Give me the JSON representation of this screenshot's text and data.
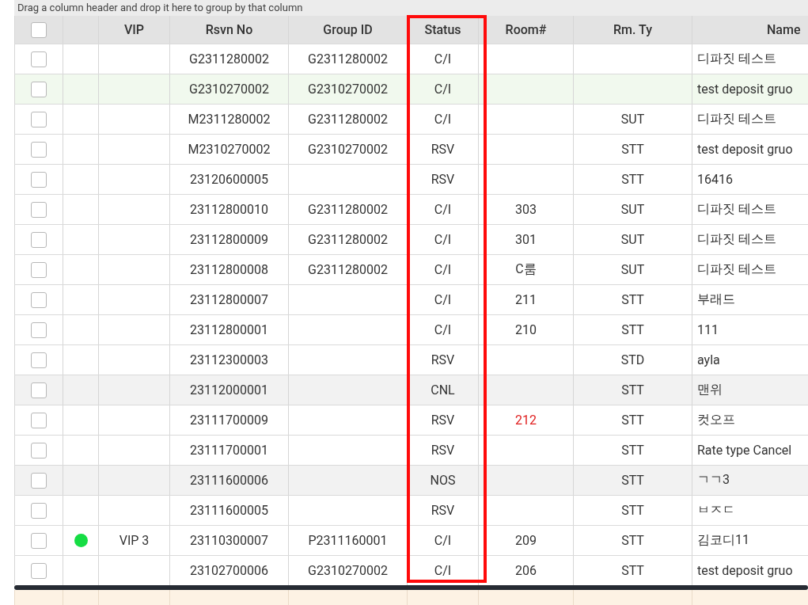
{
  "group_panel": {
    "hint": "Drag a column header and drop it here to group by that column"
  },
  "table": {
    "header_checkbox": {
      "checked": false
    },
    "columns": [
      "",
      "VIP",
      "Rsvn No",
      "Group ID",
      "Status",
      "Room#",
      "Rm. Ty",
      "Name"
    ],
    "rows": [
      {
        "checked": false,
        "vip": "",
        "rsvn_no": "G2311280002",
        "group_id": "G2311280002",
        "status": "C/I",
        "room": "",
        "room_type": "",
        "name": "디파짓 테스트"
      },
      {
        "checked": false,
        "color": "#f1f9ee",
        "vip": "",
        "rsvn_no": "G2310270002",
        "group_id": "G2310270002",
        "status": "C/I",
        "room": "",
        "room_type": "",
        "name": "test deposit gruo"
      },
      {
        "checked": false,
        "vip": "",
        "rsvn_no": "M2311280002",
        "group_id": "G2311280002",
        "status": "C/I",
        "room": "",
        "room_type": "SUT",
        "name": "디파짓 테스트"
      },
      {
        "checked": false,
        "vip": "",
        "rsvn_no": "M2310270002",
        "group_id": "G2310270002",
        "status": "RSV",
        "room": "",
        "room_type": "STT",
        "name": "test deposit gruo"
      },
      {
        "checked": false,
        "vip": "",
        "rsvn_no": "23120600005",
        "group_id": "",
        "status": "RSV",
        "room": "",
        "room_type": "STT",
        "name": "16416"
      },
      {
        "checked": false,
        "vip": "",
        "rsvn_no": "23112800010",
        "group_id": "G2311280002",
        "status": "C/I",
        "room": "303",
        "room_alert": false,
        "room_type": "SUT",
        "name": "디파짓 테스트"
      },
      {
        "checked": false,
        "vip": "",
        "rsvn_no": "23112800009",
        "group_id": "G2311280002",
        "status": "C/I",
        "room": "301",
        "room_alert": false,
        "room_type": "SUT",
        "name": "디파짓 테스트"
      },
      {
        "checked": false,
        "vip": "",
        "rsvn_no": "23112800008",
        "group_id": "G2311280002",
        "status": "C/I",
        "room": "C룸",
        "room_alert": false,
        "room_type": "SUT",
        "name": "디파짓 테스트"
      },
      {
        "checked": false,
        "vip": "",
        "rsvn_no": "23112800007",
        "group_id": "",
        "status": "C/I",
        "room": "211",
        "room_alert": false,
        "room_type": "STT",
        "name": "부래드"
      },
      {
        "checked": false,
        "vip": "",
        "rsvn_no": "23112800001",
        "group_id": "",
        "status": "C/I",
        "room": "210",
        "room_alert": false,
        "room_type": "STT",
        "name": "111"
      },
      {
        "checked": false,
        "vip": "",
        "rsvn_no": "23112300003",
        "group_id": "",
        "status": "RSV",
        "room": "",
        "room_type": "STD",
        "name": "ayla"
      },
      {
        "checked": false,
        "color": "#f2f2f2",
        "vip": "",
        "rsvn_no": "23112000001",
        "group_id": "",
        "status": "CNL",
        "room": "",
        "room_type": "STT",
        "name": "맨위"
      },
      {
        "checked": false,
        "vip": "",
        "rsvn_no": "23111700009",
        "group_id": "",
        "status": "RSV",
        "room": "212",
        "room_alert": true,
        "room_type": "STT",
        "name": "컷오프"
      },
      {
        "checked": false,
        "vip": "",
        "rsvn_no": "23111700001",
        "group_id": "",
        "status": "RSV",
        "room": "",
        "room_type": "STT",
        "name": "Rate type Cancel"
      },
      {
        "checked": false,
        "color": "#f2f2f2",
        "vip": "",
        "rsvn_no": "23111600006",
        "group_id": "",
        "status": "NOS",
        "room": "",
        "room_type": "STT",
        "name": "ㄱㄱ3"
      },
      {
        "checked": false,
        "vip": "",
        "rsvn_no": "23111600005",
        "group_id": "",
        "status": "RSV",
        "room": "",
        "room_type": "STT",
        "name": "ㅂㅈㄷ"
      },
      {
        "checked": false,
        "dot": {
          "color": "#16dd44"
        },
        "vip": "VIP 3",
        "rsvn_no": "23110300007",
        "group_id": "P2311160001",
        "status": "C/I",
        "room": "209",
        "room_alert": false,
        "room_type": "STT",
        "name": "김코디11"
      },
      {
        "checked": false,
        "vip": "",
        "rsvn_no": "23102700006",
        "group_id": "G2310270002",
        "status": "C/I",
        "room": "206",
        "room_alert": false,
        "room_type": "STT",
        "name": "test deposit gruo"
      }
    ]
  }
}
